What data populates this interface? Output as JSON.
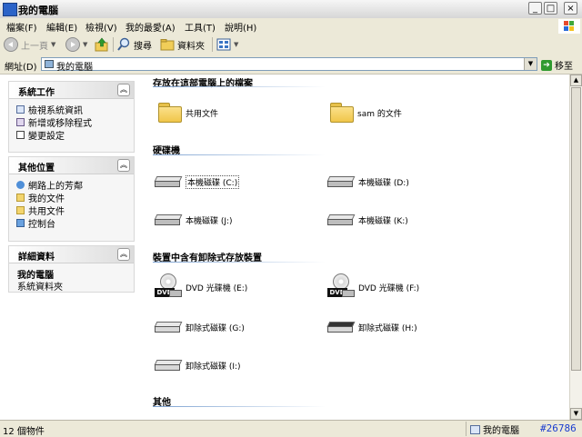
{
  "window": {
    "title": "我的電腦",
    "controls": [
      "_",
      "□",
      "×"
    ]
  },
  "menubar": {
    "items": [
      "檔案(F)",
      "編輯(E)",
      "檢視(V)",
      "我的最愛(A)",
      "工具(T)",
      "說明(H)"
    ]
  },
  "toolbar": {
    "back_label": "上一頁",
    "search_label": "搜尋",
    "folders_label": "資料夾"
  },
  "addressbar": {
    "label": "網址(D)",
    "value": "我的電腦",
    "go_label": "移至"
  },
  "sidebar": {
    "system_tasks": {
      "title": "系統工作",
      "items": [
        "檢視系統資訊",
        "新增或移除程式",
        "變更設定"
      ]
    },
    "other_places": {
      "title": "其他位置",
      "items": [
        "網路上的芳鄰",
        "我的文件",
        "共用文件",
        "控制台"
      ]
    },
    "details": {
      "title": "詳細資料",
      "name": "我的電腦",
      "type": "系統資料夾"
    }
  },
  "main": {
    "sections": [
      {
        "title": "存放在這部電腦上的檔案",
        "items": [
          "共用文件",
          "sam 的文件"
        ]
      },
      {
        "title": "硬碟機",
        "items": [
          "本機磁碟 (C:)",
          "本機磁碟 (D:)",
          "本機磁碟 (J:)",
          "本機磁碟 (K:)"
        ]
      },
      {
        "title": "裝置中含有卸除式存放裝置",
        "items": [
          "DVD 光碟機 (E:)",
          "DVD 光碟機 (F:)",
          "卸除式磁碟 (G:)",
          "卸除式磁碟 (H:)",
          "卸除式磁碟 (I:)"
        ]
      },
      {
        "title": "其他",
        "items": []
      }
    ]
  },
  "statusbar": {
    "left": "12 個物件",
    "right": "我的電腦",
    "tag": "#26786"
  },
  "colors": {
    "accent": "#2b63c8",
    "status_tag": "#1a3ccf"
  }
}
